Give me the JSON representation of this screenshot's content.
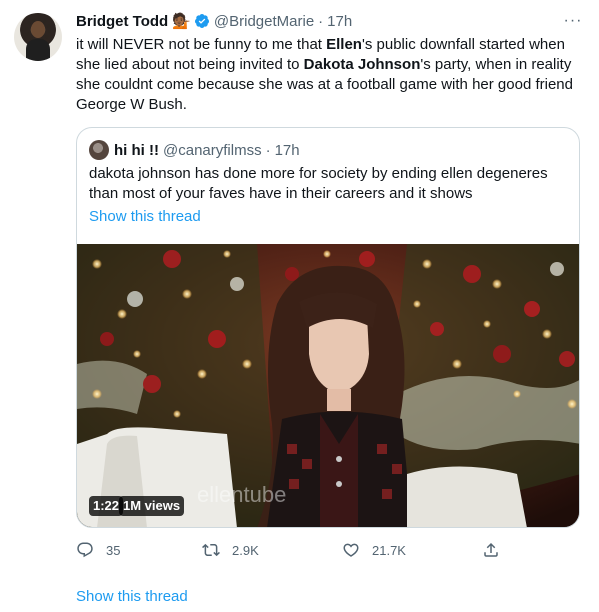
{
  "tweet": {
    "author_name": "Bridget Todd",
    "author_emoji": "💁🏾",
    "handle": "@BridgetMarie",
    "separator": "·",
    "time": "17h",
    "more_label": "···",
    "text_parts": [
      "it will NEVER not be funny to me that ",
      "Ellen",
      "'s public downfall started when she lied about not being invited to ",
      "Dakota Johnson",
      "'s party, when in reality she couldnt come because she was at a football game with her good friend George W Bush."
    ]
  },
  "quote": {
    "author_name": "hi hi !!",
    "handle": "@canaryfilmss",
    "separator": "·",
    "time": "17h",
    "text": "dakota johnson has done more for society by ending ellen degeneres than most of your faves have in their careers and it shows",
    "show_thread": "Show this thread",
    "video": {
      "duration": "1:22",
      "views": "1M views",
      "watermark": "ellentube"
    }
  },
  "actions": {
    "replies": "35",
    "retweets": "2.9K",
    "likes": "21.7K"
  },
  "show_thread": "Show this thread",
  "colors": {
    "link": "#1d9bf0",
    "secondary": "#536471",
    "verified": "#1d9bf0",
    "border": "#cfd9de"
  },
  "icons": [
    "verified-badge-icon",
    "more-icon",
    "reply-icon",
    "retweet-icon",
    "like-icon",
    "share-icon"
  ]
}
